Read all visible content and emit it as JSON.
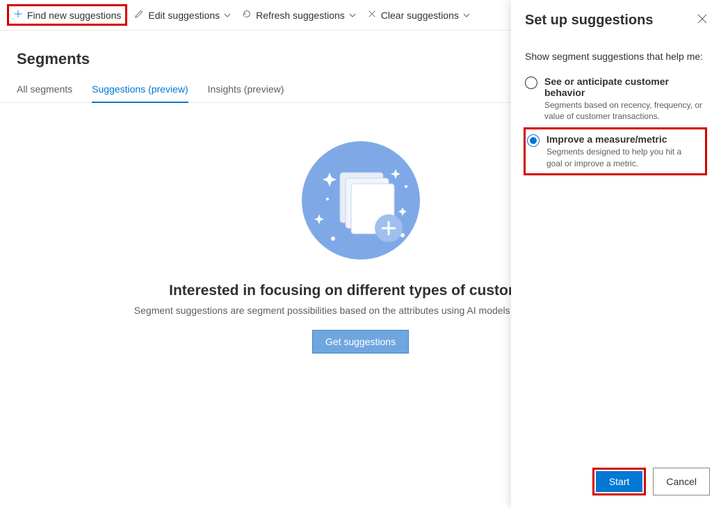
{
  "toolbar": {
    "find": "Find new suggestions",
    "edit": "Edit suggestions",
    "refresh": "Refresh suggestions",
    "clear": "Clear suggestions"
  },
  "pageTitle": "Segments",
  "tabs": {
    "all": "All segments",
    "suggestions": "Suggestions (preview)",
    "insights": "Insights (preview)"
  },
  "empty": {
    "heading": "Interested in focusing on different types of customers?",
    "sub": "Segment suggestions are segment possibilities based on the attributes using AI models or based on activ",
    "cta": "Get suggestions"
  },
  "panel": {
    "title": "Set up suggestions",
    "subtitle": "Show segment suggestions that help me:",
    "opt1": {
      "title": "See or anticipate customer behavior",
      "desc": "Segments based on recency, frequency, or value of customer transactions."
    },
    "opt2": {
      "title": "Improve a measure/metric",
      "desc": "Segments designed to help you hit a goal or improve a metric."
    },
    "start": "Start",
    "cancel": "Cancel"
  }
}
